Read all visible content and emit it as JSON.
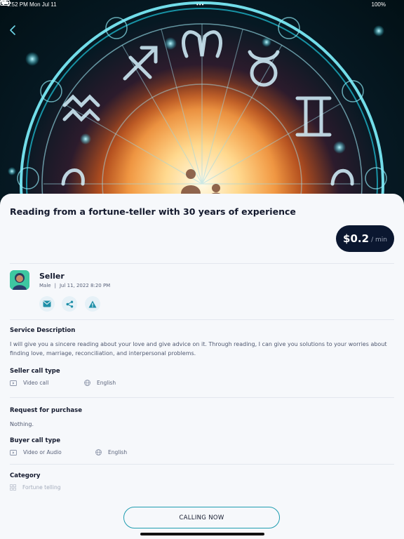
{
  "status_bar": {
    "time": "9:52 PM",
    "date": "Mon Jul 11",
    "dots": "•••",
    "battery": "100%"
  },
  "hero": {
    "image": "zodiac-wheel-fortune-teller"
  },
  "listing": {
    "title": "Reading from a fortune-teller with 30 years of experience",
    "price": "$0.2",
    "price_unit": "/ min"
  },
  "seller": {
    "name": "Seller",
    "gender": "Male",
    "separator": "|",
    "date": "Jul 11, 2022  8:20 PM",
    "actions": [
      {
        "icon": "mail-icon"
      },
      {
        "icon": "share-icon"
      },
      {
        "icon": "warning-icon"
      }
    ]
  },
  "service_description": {
    "label": "Service Description",
    "text": "I will give you a sincere reading about your love and give advice on it. Through reading, I can give you solutions to your worries about finding love, marriage, reconciliation, and interpersonal problems."
  },
  "seller_call_type": {
    "label": "Seller call type",
    "call": "Video call",
    "language": "English"
  },
  "request_for_purchase": {
    "label": "Request for purchase",
    "text": "Nothing."
  },
  "buyer_call_type": {
    "label": "Buyer call type",
    "call": "Video or Audio",
    "language": "English"
  },
  "category": {
    "label": "Category",
    "value": "Fortune telling"
  },
  "cta": {
    "label": "CALLING NOW"
  },
  "colors": {
    "accent": "#1f9db0",
    "price_bg": "#0b1730",
    "text": "#141a2e",
    "avatar_bg": "#3ec7a1"
  }
}
